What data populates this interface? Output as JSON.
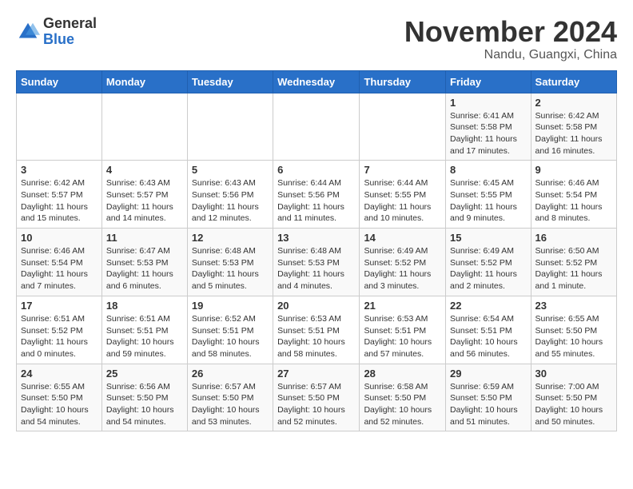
{
  "header": {
    "logo_general": "General",
    "logo_blue": "Blue",
    "month_title": "November 2024",
    "location": "Nandu, Guangxi, China"
  },
  "days_of_week": [
    "Sunday",
    "Monday",
    "Tuesday",
    "Wednesday",
    "Thursday",
    "Friday",
    "Saturday"
  ],
  "weeks": [
    [
      {
        "num": "",
        "info": ""
      },
      {
        "num": "",
        "info": ""
      },
      {
        "num": "",
        "info": ""
      },
      {
        "num": "",
        "info": ""
      },
      {
        "num": "",
        "info": ""
      },
      {
        "num": "1",
        "info": "Sunrise: 6:41 AM\nSunset: 5:58 PM\nDaylight: 11 hours and 17 minutes."
      },
      {
        "num": "2",
        "info": "Sunrise: 6:42 AM\nSunset: 5:58 PM\nDaylight: 11 hours and 16 minutes."
      }
    ],
    [
      {
        "num": "3",
        "info": "Sunrise: 6:42 AM\nSunset: 5:57 PM\nDaylight: 11 hours and 15 minutes."
      },
      {
        "num": "4",
        "info": "Sunrise: 6:43 AM\nSunset: 5:57 PM\nDaylight: 11 hours and 14 minutes."
      },
      {
        "num": "5",
        "info": "Sunrise: 6:43 AM\nSunset: 5:56 PM\nDaylight: 11 hours and 12 minutes."
      },
      {
        "num": "6",
        "info": "Sunrise: 6:44 AM\nSunset: 5:56 PM\nDaylight: 11 hours and 11 minutes."
      },
      {
        "num": "7",
        "info": "Sunrise: 6:44 AM\nSunset: 5:55 PM\nDaylight: 11 hours and 10 minutes."
      },
      {
        "num": "8",
        "info": "Sunrise: 6:45 AM\nSunset: 5:55 PM\nDaylight: 11 hours and 9 minutes."
      },
      {
        "num": "9",
        "info": "Sunrise: 6:46 AM\nSunset: 5:54 PM\nDaylight: 11 hours and 8 minutes."
      }
    ],
    [
      {
        "num": "10",
        "info": "Sunrise: 6:46 AM\nSunset: 5:54 PM\nDaylight: 11 hours and 7 minutes."
      },
      {
        "num": "11",
        "info": "Sunrise: 6:47 AM\nSunset: 5:53 PM\nDaylight: 11 hours and 6 minutes."
      },
      {
        "num": "12",
        "info": "Sunrise: 6:48 AM\nSunset: 5:53 PM\nDaylight: 11 hours and 5 minutes."
      },
      {
        "num": "13",
        "info": "Sunrise: 6:48 AM\nSunset: 5:53 PM\nDaylight: 11 hours and 4 minutes."
      },
      {
        "num": "14",
        "info": "Sunrise: 6:49 AM\nSunset: 5:52 PM\nDaylight: 11 hours and 3 minutes."
      },
      {
        "num": "15",
        "info": "Sunrise: 6:49 AM\nSunset: 5:52 PM\nDaylight: 11 hours and 2 minutes."
      },
      {
        "num": "16",
        "info": "Sunrise: 6:50 AM\nSunset: 5:52 PM\nDaylight: 11 hours and 1 minute."
      }
    ],
    [
      {
        "num": "17",
        "info": "Sunrise: 6:51 AM\nSunset: 5:52 PM\nDaylight: 11 hours and 0 minutes."
      },
      {
        "num": "18",
        "info": "Sunrise: 6:51 AM\nSunset: 5:51 PM\nDaylight: 10 hours and 59 minutes."
      },
      {
        "num": "19",
        "info": "Sunrise: 6:52 AM\nSunset: 5:51 PM\nDaylight: 10 hours and 58 minutes."
      },
      {
        "num": "20",
        "info": "Sunrise: 6:53 AM\nSunset: 5:51 PM\nDaylight: 10 hours and 58 minutes."
      },
      {
        "num": "21",
        "info": "Sunrise: 6:53 AM\nSunset: 5:51 PM\nDaylight: 10 hours and 57 minutes."
      },
      {
        "num": "22",
        "info": "Sunrise: 6:54 AM\nSunset: 5:51 PM\nDaylight: 10 hours and 56 minutes."
      },
      {
        "num": "23",
        "info": "Sunrise: 6:55 AM\nSunset: 5:50 PM\nDaylight: 10 hours and 55 minutes."
      }
    ],
    [
      {
        "num": "24",
        "info": "Sunrise: 6:55 AM\nSunset: 5:50 PM\nDaylight: 10 hours and 54 minutes."
      },
      {
        "num": "25",
        "info": "Sunrise: 6:56 AM\nSunset: 5:50 PM\nDaylight: 10 hours and 54 minutes."
      },
      {
        "num": "26",
        "info": "Sunrise: 6:57 AM\nSunset: 5:50 PM\nDaylight: 10 hours and 53 minutes."
      },
      {
        "num": "27",
        "info": "Sunrise: 6:57 AM\nSunset: 5:50 PM\nDaylight: 10 hours and 52 minutes."
      },
      {
        "num": "28",
        "info": "Sunrise: 6:58 AM\nSunset: 5:50 PM\nDaylight: 10 hours and 52 minutes."
      },
      {
        "num": "29",
        "info": "Sunrise: 6:59 AM\nSunset: 5:50 PM\nDaylight: 10 hours and 51 minutes."
      },
      {
        "num": "30",
        "info": "Sunrise: 7:00 AM\nSunset: 5:50 PM\nDaylight: 10 hours and 50 minutes."
      }
    ]
  ]
}
